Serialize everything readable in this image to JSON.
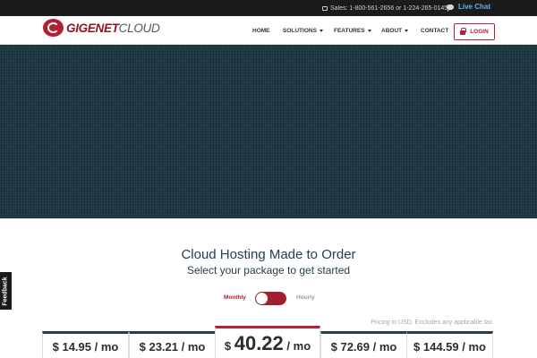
{
  "topbar": {
    "sales_text": "Sales: 1-800-561-2656 or 1-224-265-0145",
    "live_chat_label": "Live Chat",
    "phone_icon": "phone-icon",
    "chat_icon": "chat-bubble-icon"
  },
  "brand": {
    "name_strong": "GIGENET",
    "name_light": "CLOUD",
    "accent_color": "#b32033",
    "dark_color": "#233f4b"
  },
  "nav": {
    "items": [
      {
        "label": "HOME",
        "has_dropdown": false
      },
      {
        "label": "SOLUTIONS",
        "has_dropdown": true
      },
      {
        "label": "FEATURES",
        "has_dropdown": true
      },
      {
        "label": "ABOUT",
        "has_dropdown": true
      },
      {
        "label": "CONTACT",
        "has_dropdown": false
      }
    ],
    "login_label": "LOGIN",
    "login_icon": "lock-icon"
  },
  "main": {
    "heading": "Cloud Hosting Made to Order",
    "subheading": "Select your package to get started",
    "billing_toggle": {
      "monthly_label": "Monthly",
      "hourly_label": "Hourly",
      "selected": "Monthly"
    },
    "pricing_note": "Pricing in USD. Excludes any applicable tax.",
    "plans": [
      {
        "currency": "$",
        "amount": "14.95",
        "unit": "/ mo",
        "featured": false
      },
      {
        "currency": "$",
        "amount": "23.21",
        "unit": "/ mo",
        "featured": false
      },
      {
        "currency": "$",
        "amount": "40.22",
        "unit": "/ mo",
        "featured": true
      },
      {
        "currency": "$",
        "amount": "72.69",
        "unit": "/ mo",
        "featured": false
      },
      {
        "currency": "$",
        "amount": "144.59",
        "unit": "/ mo",
        "featured": false
      }
    ]
  },
  "feedback_label": "Feedback"
}
